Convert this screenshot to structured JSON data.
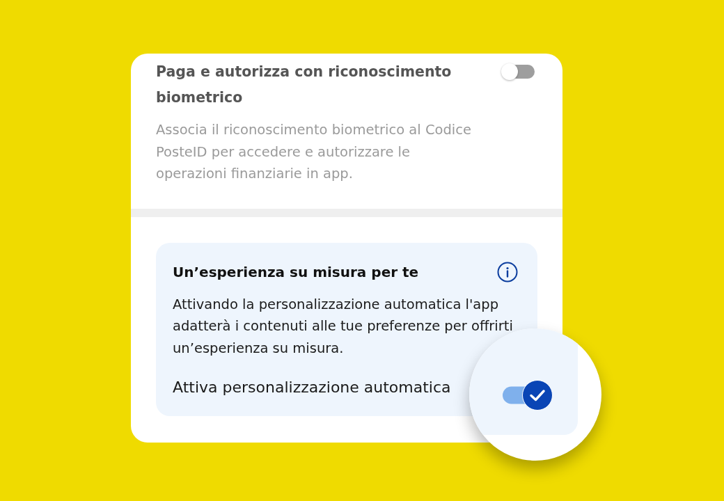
{
  "biometric_setting": {
    "title": "Paga e autorizza con riconoscimento biometrico",
    "description": "Associa il riconoscimento biometrico al Codice PosteID per accedere e autorizzare le operazioni finanziarie in app.",
    "on": false
  },
  "personalization_card": {
    "title": "Un’esperienza su misura per te",
    "description": "Attivando la personalizzazione automatica l'app adatterà i contenuti alle tue preferenze per offrirti un’esperienza su misura.",
    "toggle_label": "Attiva personalizzazione automatica",
    "on": true
  }
}
